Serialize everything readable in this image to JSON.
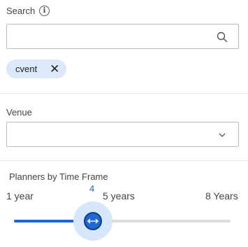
{
  "search": {
    "label": "Search",
    "info_icon": "info-icon",
    "value": "",
    "placeholder": "",
    "icon": "search-icon"
  },
  "chips": [
    {
      "label": "cvent",
      "remove_icon": "close-icon"
    }
  ],
  "venue": {
    "label": "Venue",
    "value": "",
    "icon": "chevron-down-icon"
  },
  "slider": {
    "title": "Planners by Time Frame",
    "min_label": "1 year",
    "mid_label": "5 years",
    "max_label": "8 Years",
    "current_value": "4",
    "value": 4,
    "min": 1,
    "max": 8,
    "accent_color": "#1f68d3",
    "track_color": "#dcdcdc"
  }
}
